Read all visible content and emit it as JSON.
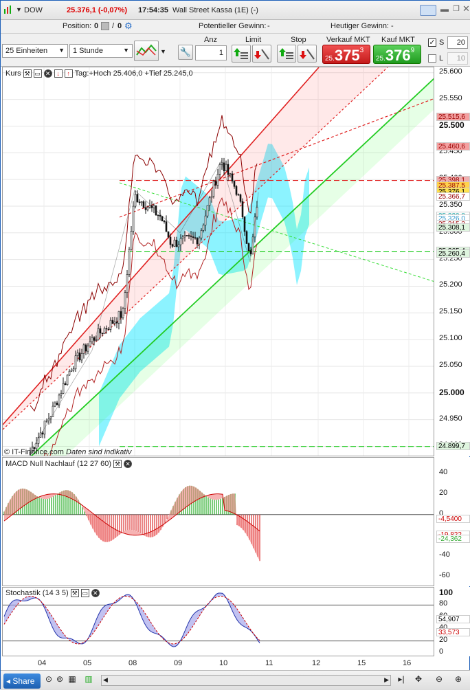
{
  "header": {
    "symbol": "DOW",
    "price_change": "25.376,1 (-0,07%)",
    "time": "17:54:35",
    "instrument": "Wall Street Kassa (1E) (-)"
  },
  "positions": {
    "position_label": "Position:",
    "position_value": "0",
    "position_value2": "0",
    "potential_label": "Potentieller Gewinn:",
    "potential_value": "-",
    "today_label": "Heutiger Gewinn:",
    "today_value": "-"
  },
  "toolbar": {
    "units": "25 Einheiten",
    "interval": "1 Stunde",
    "anz_label": "Anz",
    "anz_value": "1",
    "limit_label": "Limit",
    "stop_label": "Stop",
    "sell_label": "Verkauf MKT",
    "sell_prefix": "25.",
    "sell_main": "375",
    "sell_sup": "3",
    "buy_label": "Kauf MKT",
    "buy_prefix": "25.",
    "buy_main": "376",
    "buy_sup": "9",
    "s_label": "S",
    "s_value": "20",
    "l_label": "L",
    "l_value": "10"
  },
  "price_panel": {
    "label": "Kurs",
    "info": "Tag:+Hoch 25.406,0 +Tief 25.245,0",
    "credit": "© IT-Finance.com",
    "credit_note": "Daten sind indikativ",
    "ticks": [
      "25.600",
      "25.550",
      "25.500",
      "25.450",
      "25.400",
      "25.350",
      "25.300",
      "25.250",
      "25.200",
      "25.150",
      "25.100",
      "25.050",
      "25.000",
      "24.950",
      "24.900"
    ],
    "badges": [
      {
        "text": "25.515,6",
        "bg": "#f4a0a0",
        "color": "#900"
      },
      {
        "text": "25.460,6",
        "bg": "#f4a0a0",
        "color": "#900"
      },
      {
        "text": "25.398,1",
        "bg": "#f0b0b0",
        "color": "#900"
      },
      {
        "text": "25.387,5",
        "bg": "#ffd24d",
        "color": "#900"
      },
      {
        "text": "25.376,1",
        "bg": "#ffe14d",
        "color": "#000"
      },
      {
        "text": "25.366,7",
        "bg": "#fff",
        "color": "#900"
      },
      {
        "text": "25.330,8",
        "bg": "#fff",
        "color": "#2aa"
      },
      {
        "text": "25.326,0",
        "bg": "#fff",
        "color": "#39c"
      },
      {
        "text": "25.315,3",
        "bg": "#fff",
        "color": "#900"
      },
      {
        "text": "25.308,1",
        "bg": "#dff5df",
        "color": "#000"
      },
      {
        "text": "25.265,4",
        "bg": "#dff5df",
        "color": "#000"
      },
      {
        "text": "25.260,4",
        "bg": "#dff5df",
        "color": "#000"
      },
      {
        "text": "24.899,7",
        "bg": "#dff5df",
        "color": "#000"
      }
    ]
  },
  "macd_panel": {
    "label": "MACD Null Nachlauf (12 27 60)",
    "ticks": [
      "40",
      "20",
      "0",
      "-20",
      "-40",
      "-60"
    ],
    "badges": [
      {
        "text": "-4,5400",
        "color": "#c00"
      },
      {
        "text": "-19,822",
        "color": "#c00"
      },
      {
        "text": "-24,362",
        "color": "#3a3"
      }
    ]
  },
  "stoch_panel": {
    "label": "Stochastik (14 3 5)",
    "ticks": [
      "100",
      "80",
      "60",
      "40",
      "20",
      "0"
    ],
    "badges": [
      {
        "text": "54,907",
        "color": "#000"
      },
      {
        "text": "33,573",
        "color": "#c00"
      }
    ]
  },
  "x_axis": [
    "04",
    "05",
    "08",
    "09",
    "10",
    "11",
    "12",
    "15",
    "16"
  ],
  "footer": {
    "share": "Share"
  },
  "chart_data": {
    "type": "line",
    "title": "",
    "x": [
      "04",
      "05",
      "08",
      "09",
      "10"
    ],
    "series": [
      {
        "values": [
          24890,
          25080,
          25380,
          25300,
          25435,
          25245,
          25376
        ]
      }
    ],
    "ylim": [
      24880,
      25610
    ]
  },
  "colors": {
    "up": "#2a2",
    "down": "#d22",
    "cloud": "#00e5ff",
    "accent": "#1c5fb8"
  }
}
